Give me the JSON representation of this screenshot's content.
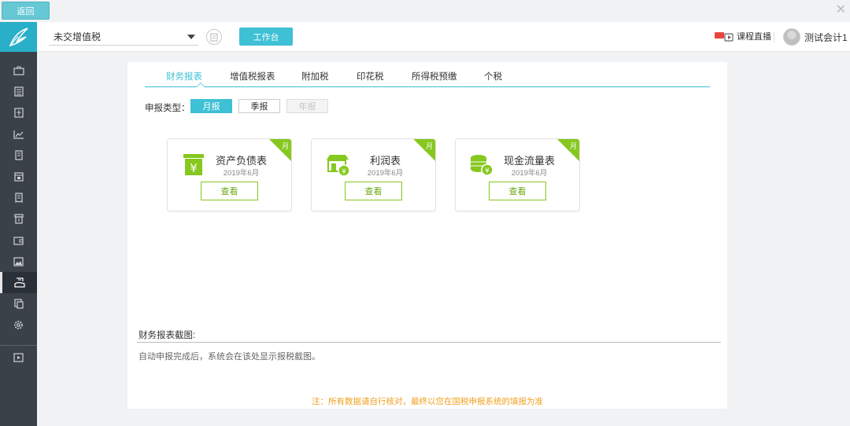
{
  "top": {
    "back_label": "返回",
    "close_glyph": "✕"
  },
  "header": {
    "tax_select_value": "未交增值税",
    "workbench_label": "工作台",
    "live_label": "课程直播",
    "user_name": "测试会计1"
  },
  "sidebar": {
    "items": [
      {
        "icon": "briefcase-icon"
      },
      {
        "icon": "ledger-icon"
      },
      {
        "icon": "voucher-icon"
      },
      {
        "icon": "chart-icon"
      },
      {
        "icon": "building-icon"
      },
      {
        "icon": "calendar-icon"
      },
      {
        "icon": "receipt-icon"
      },
      {
        "icon": "archive-icon"
      },
      {
        "icon": "wallet-icon"
      },
      {
        "icon": "picture-icon"
      },
      {
        "icon": "tax-declare-icon",
        "active": true
      },
      {
        "icon": "copy-icon"
      },
      {
        "icon": "settings-icon"
      }
    ],
    "bottom_icon": "play-icon"
  },
  "tabs": [
    "财务报表",
    "增值税报表",
    "附加税",
    "印花税",
    "所得税预缴",
    "个税"
  ],
  "active_tab": 0,
  "report_type": {
    "label": "申报类型：",
    "options": [
      "月报",
      "季报",
      "年报"
    ],
    "selected": "月报",
    "disabled": "年报"
  },
  "cards": [
    {
      "title": "资产负债表",
      "date": "2019年6月",
      "button": "查看",
      "badge": "月",
      "icon": "balance-sheet-icon"
    },
    {
      "title": "利润表",
      "date": "2019年6月",
      "button": "查看",
      "badge": "月",
      "icon": "profit-icon"
    },
    {
      "title": "现金流量表",
      "date": "2019年6月",
      "button": "查看",
      "badge": "月",
      "icon": "cash-flow-icon"
    }
  ],
  "screenshot_section": {
    "title": "财务报表截图:",
    "description": "自动申报完成后，系统会在该处显示报税截图。"
  },
  "note": "注：所有数据请自行核对，最终以您在国税申报系统的填报为准",
  "colors": {
    "accent": "#3ec0d5",
    "green": "#86c81f",
    "sidebar": "#3a4149",
    "note": "#f0a020"
  }
}
